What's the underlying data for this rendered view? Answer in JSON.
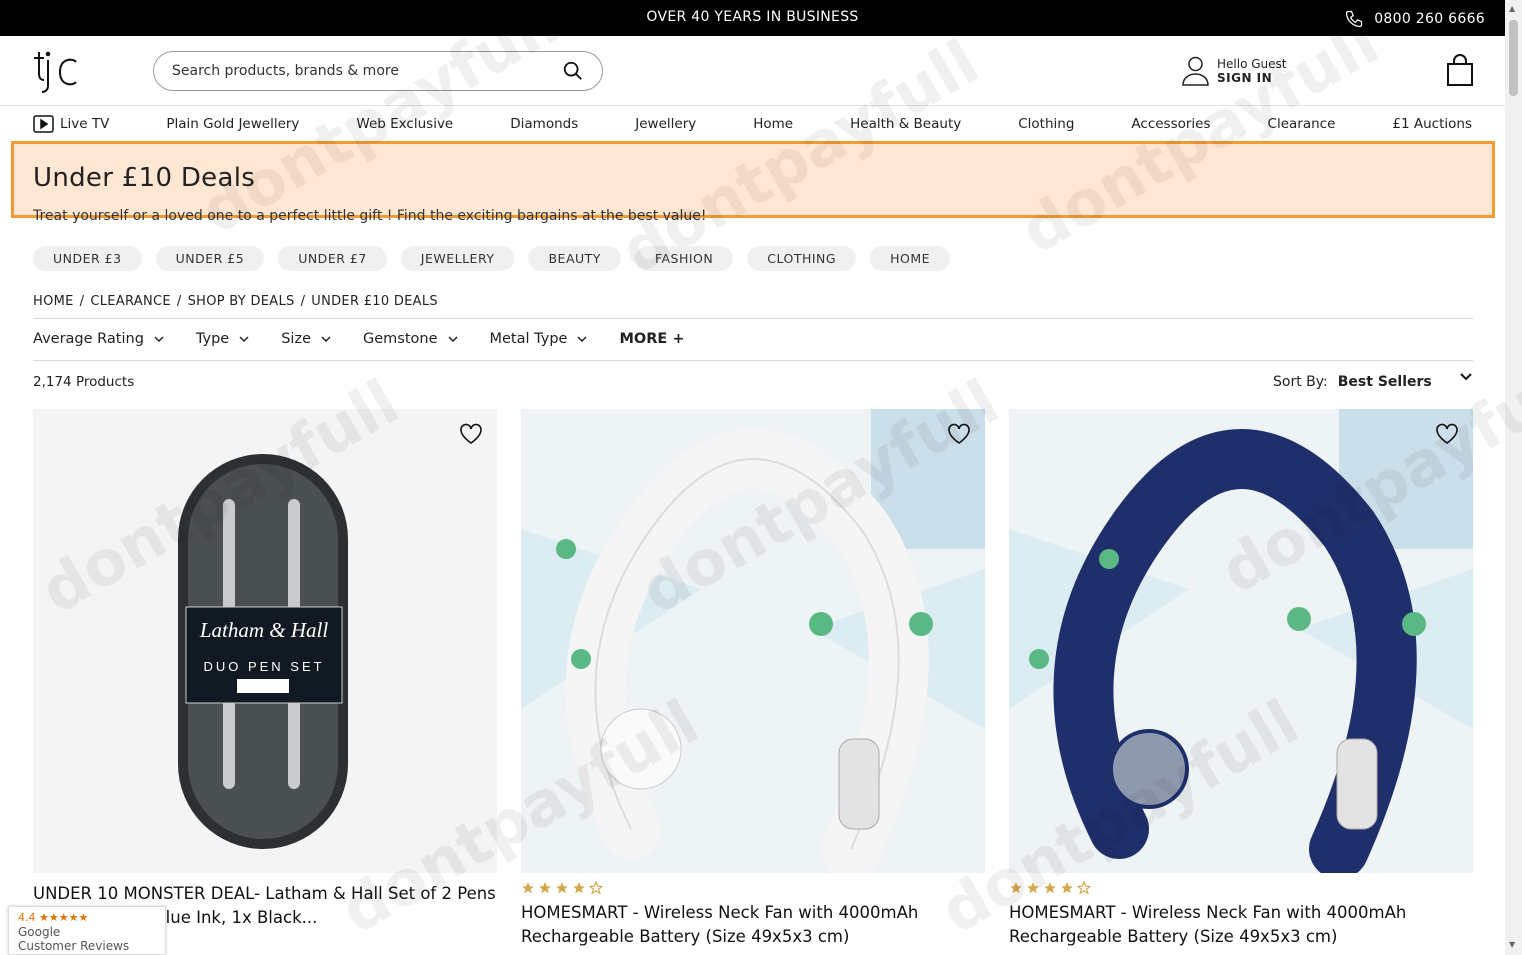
{
  "topbar": {
    "center_text": "OVER 40 YEARS IN BUSINESS",
    "phone": "0800 260 6666"
  },
  "header": {
    "logo_text": "tjc",
    "search_placeholder": "Search products, brands & more",
    "greeting": "Hello Guest",
    "sign_in": "SIGN IN"
  },
  "nav": [
    "Live TV",
    "Plain Gold Jewellery",
    "Web Exclusive",
    "Diamonds",
    "Jewellery",
    "Home",
    "Health & Beauty",
    "Clothing",
    "Accessories",
    "Clearance",
    "£1 Auctions"
  ],
  "page": {
    "title": "Under £10 Deals",
    "subtitle": "Treat yourself or a loved one to a perfect little gift ! Find the exciting bargains at the best value!"
  },
  "chips": [
    "UNDER £3",
    "UNDER £5",
    "UNDER £7",
    "JEWELLERY",
    "BEAUTY",
    "FASHION",
    "CLOTHING",
    "HOME"
  ],
  "breadcrumb": [
    "HOME",
    "CLEARANCE",
    "SHOP BY DEALS",
    "UNDER £10 DEALS"
  ],
  "filters": [
    "Average Rating",
    "Type",
    "Size",
    "Gemstone",
    "Metal Type"
  ],
  "filters_more": "MORE +",
  "results": {
    "count": "2,174 Products",
    "sort_label": "Sort By:",
    "sort_value": "Best Sellers"
  },
  "products": [
    {
      "name": "UNDER 10 MONSTER DEAL- Latham & Hall Set of 2 Pens with Stylus 1x Blue Ink, 1x Black...",
      "rating": 0,
      "img_text_1": "Latham & Hall",
      "img_text_2": "DUO PEN SET"
    },
    {
      "name": "HOMESMART - Wireless Neck Fan with 4000mAh Rechargeable Battery (Size 49x5x3 cm)",
      "rating": 4
    },
    {
      "name": "HOMESMART - Wireless Neck Fan with 4000mAh Rechargeable Battery (Size 49x5x3 cm)",
      "rating": 4
    }
  ],
  "google_badge": {
    "rating": "4.4",
    "brand": "Google",
    "label": "Customer Reviews"
  },
  "watermark": "dontpayfull",
  "colors": {
    "accent": "#f29b33",
    "highlight": "#ffe7d4",
    "star": "#d4a84a",
    "fan_blue": "#1f2f6b"
  }
}
